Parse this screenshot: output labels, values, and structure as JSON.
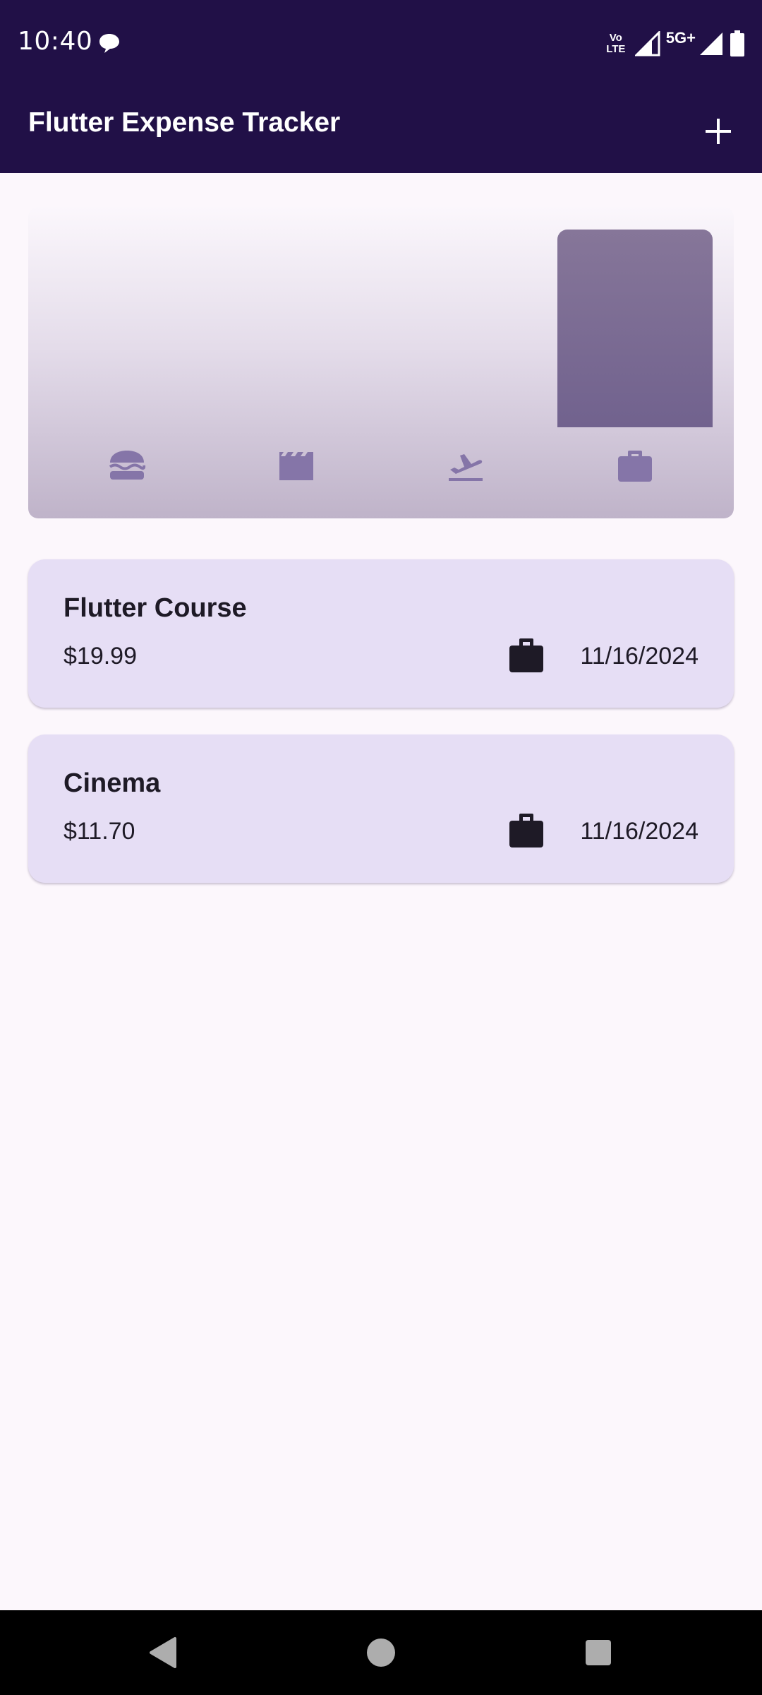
{
  "status_bar": {
    "time": "10:40",
    "volte_line1": "Vo",
    "volte_line2": "LTE",
    "network": "5G+"
  },
  "app_bar": {
    "title": "Flutter Expense Tracker",
    "add_icon": "plus-icon"
  },
  "chart": {
    "categories": [
      {
        "name": "food",
        "icon": "burger-icon",
        "fill": 0
      },
      {
        "name": "leisure",
        "icon": "clapperboard-icon",
        "fill": 0
      },
      {
        "name": "travel",
        "icon": "flight-takeoff-icon",
        "fill": 0
      },
      {
        "name": "work",
        "icon": "briefcase-icon",
        "fill": 1
      }
    ],
    "bar_color": "#7A6A95",
    "icon_color": "#8575A8"
  },
  "expenses": [
    {
      "title": "Flutter Course",
      "amount": "$19.99",
      "category_icon": "briefcase-icon",
      "date": "11/16/2024"
    },
    {
      "title": "Cinema",
      "amount": "$11.70",
      "category_icon": "briefcase-icon",
      "date": "11/16/2024"
    }
  ],
  "colors": {
    "app_bar": "#211047",
    "background": "#FCF7FC",
    "card": "#E6DEF5"
  }
}
